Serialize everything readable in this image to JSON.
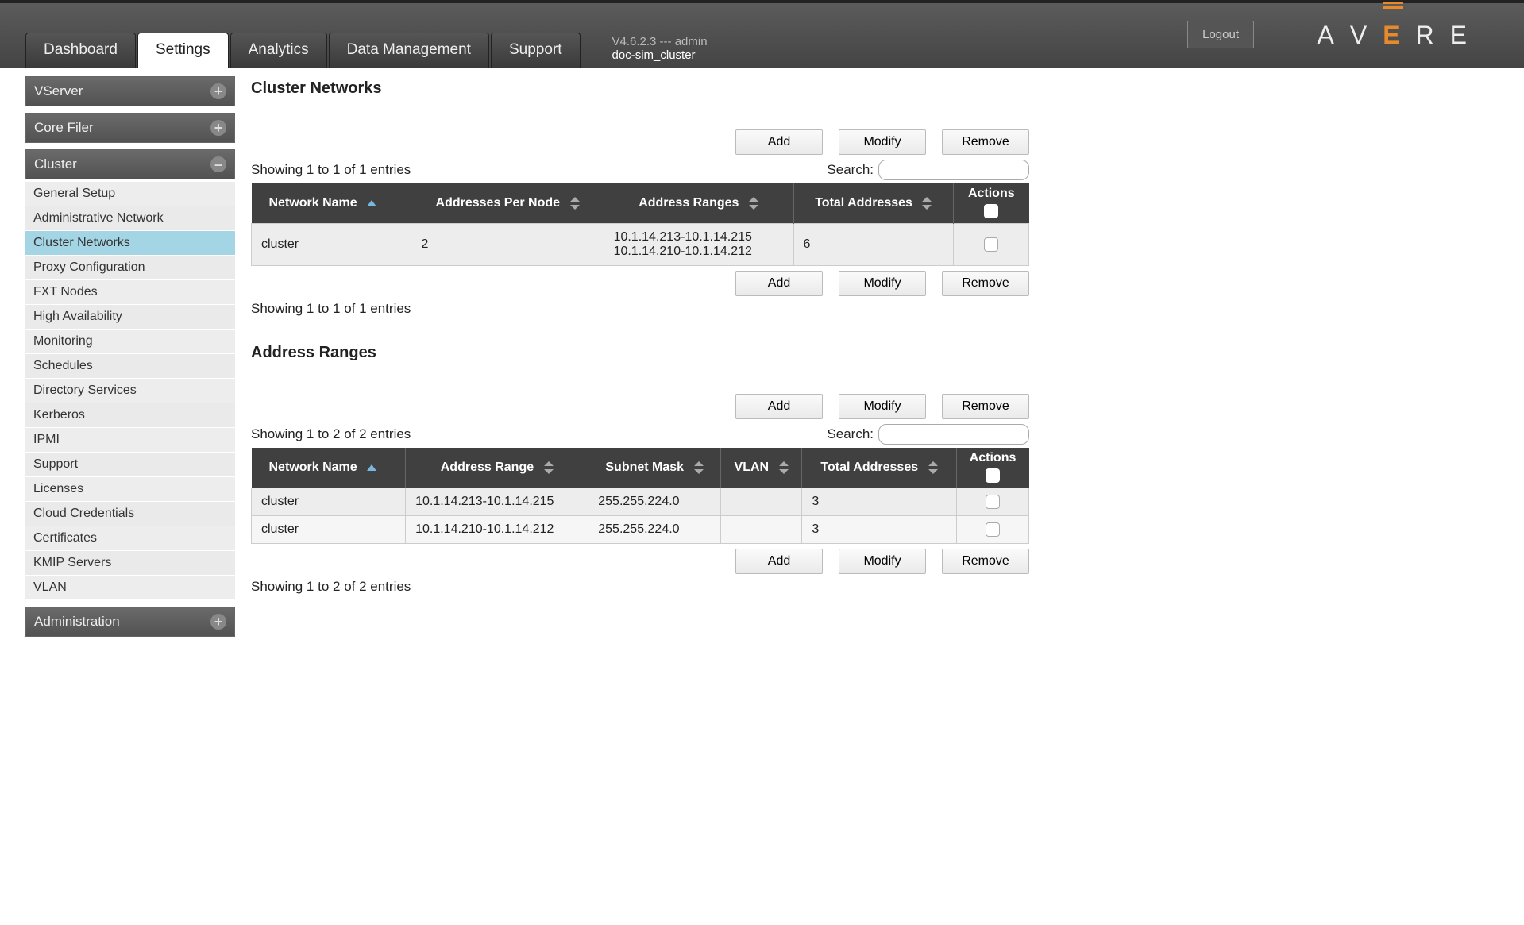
{
  "header": {
    "logout": "Logout",
    "version_line": "V4.6.2.3 --- admin",
    "cluster_name": "doc-sim_cluster",
    "tabs": {
      "dashboard": "Dashboard",
      "settings": "Settings",
      "analytics": "Analytics",
      "data_mgmt": "Data Management",
      "support": "Support"
    }
  },
  "sidebar": {
    "vserver": "VServer",
    "core_filer": "Core Filer",
    "cluster": "Cluster",
    "administration": "Administration",
    "cluster_items": {
      "general_setup": "General Setup",
      "admin_network": "Administrative Network",
      "cluster_networks": "Cluster Networks",
      "proxy_config": "Proxy Configuration",
      "fxt_nodes": "FXT Nodes",
      "high_availability": "High Availability",
      "monitoring": "Monitoring",
      "schedules": "Schedules",
      "directory_services": "Directory Services",
      "kerberos": "Kerberos",
      "ipmi": "IPMI",
      "support": "Support",
      "licenses": "Licenses",
      "cloud_credentials": "Cloud Credentials",
      "certificates": "Certificates",
      "kmip_servers": "KMIP Servers",
      "vlan": "VLAN"
    }
  },
  "buttons": {
    "add": "Add",
    "modify": "Modify",
    "remove": "Remove"
  },
  "labels": {
    "search": "Search:"
  },
  "networks": {
    "title": "Cluster Networks",
    "entries_info_top": "Showing 1 to 1 of 1 entries",
    "entries_info_bottom": "Showing 1 to 1 of 1 entries",
    "headers": {
      "name": "Network Name",
      "addr_per_node": "Addresses Per Node",
      "addr_ranges": "Address Ranges",
      "total": "Total Addresses",
      "actions": "Actions"
    },
    "rows": [
      {
        "name": "cluster",
        "addr_per_node": "2",
        "addr_ranges_l1": "10.1.14.213-10.1.14.215",
        "addr_ranges_l2": "10.1.14.210-10.1.14.212",
        "total": "6"
      }
    ]
  },
  "ranges": {
    "title": "Address Ranges",
    "entries_info_top": "Showing 1 to 2 of 2 entries",
    "entries_info_bottom": "Showing 1 to 2 of 2 entries",
    "headers": {
      "name": "Network Name",
      "range": "Address Range",
      "mask": "Subnet Mask",
      "vlan": "VLAN",
      "total": "Total Addresses",
      "actions": "Actions"
    },
    "rows": [
      {
        "name": "cluster",
        "range": "10.1.14.213-10.1.14.215",
        "mask": "255.255.224.0",
        "vlan": "",
        "total": "3"
      },
      {
        "name": "cluster",
        "range": "10.1.14.210-10.1.14.212",
        "mask": "255.255.224.0",
        "vlan": "",
        "total": "3"
      }
    ]
  }
}
